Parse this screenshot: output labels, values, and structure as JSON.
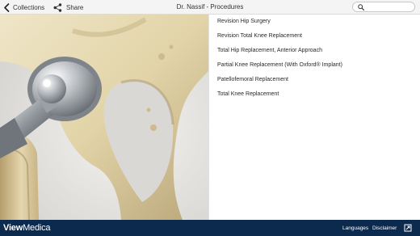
{
  "header": {
    "back_label": "Collections",
    "share_label": "Share",
    "title": "Dr. Nassif - Procedures",
    "icons": {
      "back": "chevron-left-icon",
      "share": "share-icon",
      "search": "search-icon"
    }
  },
  "procedures": [
    "Revision Hip Surgery",
    "Revision Total Knee Replacement",
    "Total Hip Replacement, Anterior Approach",
    "Partial Knee Replacement (With Oxford® Implant)",
    "Patellofemoral Replacement",
    "Total Knee Replacement"
  ],
  "footer": {
    "brand_bold": "View",
    "brand_light": "Medica",
    "languages": "Languages",
    "disclaimer": "Disclaimer",
    "fullscreen_icon": "fullscreen-icon"
  },
  "colors": {
    "footer_bg": "#0c2a4e",
    "topbar_bg": "#f4f4f4"
  }
}
